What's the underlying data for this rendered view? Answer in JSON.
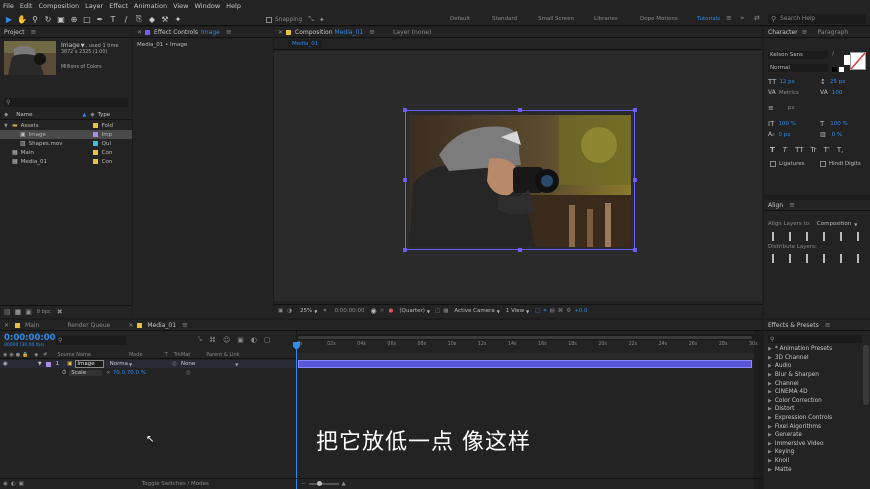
{
  "menu": [
    "File",
    "Edit",
    "Composition",
    "Layer",
    "Effect",
    "Animation",
    "View",
    "Window",
    "Help"
  ],
  "toolbar": {
    "snapping_label": "Snapping",
    "workspaces": [
      "Default",
      "Standard",
      "Small Screen",
      "Libraries",
      "Dope Motions",
      "Tutorials"
    ],
    "active_workspace": "Tutorials",
    "search_placeholder": "Search Help"
  },
  "project": {
    "title": "Project",
    "selected_name": "Image",
    "selected_used": ", used 1 time",
    "selected_dims": "3872 x 2325 (1.00)",
    "selected_colors": "Millions of Colors",
    "col_name": "Name",
    "col_type": "Type",
    "items": [
      {
        "name": "Assets",
        "type": "Fold",
        "color": "#e5c33c",
        "indent": 0,
        "kind": "folder"
      },
      {
        "name": "Image",
        "type": "Imp",
        "color": "#a98de8",
        "indent": 1,
        "kind": "image",
        "selected": true
      },
      {
        "name": "Shapes.mov",
        "type": "Qui",
        "color": "#38c5d6",
        "indent": 1,
        "kind": "movie"
      },
      {
        "name": "Main",
        "type": "Con",
        "color": "#e5c33c",
        "indent": 0,
        "kind": "comp"
      },
      {
        "name": "Media_01",
        "type": "Con",
        "color": "#e5c33c",
        "indent": 0,
        "kind": "comp"
      }
    ],
    "bpc": "8 bpc"
  },
  "effect_controls": {
    "title_prefix": "Effect Controls",
    "title_layer": "Image",
    "subtitle": "Media_01 • Image"
  },
  "composition": {
    "title_prefix": "Composition",
    "title_name": "Media_01",
    "layer_tab": "Layer (none)",
    "sub_tab": "Media_01",
    "zoom": "25%",
    "timecode": "0:00:00:00",
    "resolution": "(Quarter)",
    "camera": "Active Camera",
    "views": "1 View",
    "exposure": "+0.0"
  },
  "timeline": {
    "tabs": [
      "Main",
      "Render Queue",
      "Media_01"
    ],
    "active_tab": "Media_01",
    "timecode": "0:00:00:00",
    "fps": "00000 (30.00 fps)",
    "cols": {
      "num": "#",
      "source": "Source Name",
      "mode": "Mode",
      "t": "T",
      "trkmat": "TrkMat",
      "parent": "Parent & Link"
    },
    "layer": {
      "num": "1",
      "name": "Image",
      "mode": "Norma",
      "parent": "None"
    },
    "property": {
      "name": "Scale",
      "value": "70.0,70.0 %"
    },
    "ruler": [
      "0s",
      "02s",
      "04s",
      "06s",
      "08s",
      "10s",
      "12s",
      "14s",
      "16s",
      "18s",
      "20s",
      "22s",
      "24s",
      "26s",
      "28s",
      "30s"
    ],
    "toggle_label": "Toggle Switches / Modes",
    "subtitle": "把它放低一点 像这样"
  },
  "character": {
    "title": "Character",
    "paragraph_tab": "Paragraph",
    "font": "Kelson Sans",
    "style": "Normal",
    "size": "12 px",
    "leading": "25 px",
    "kerning": "Metrics",
    "tracking": "100",
    "stroke": "px",
    "vscale": "100 %",
    "hscale": "100 %",
    "baseline": "0 px",
    "tsume": "0 %",
    "styles": [
      "T",
      "T",
      "TT",
      "Tr",
      "T'",
      "T,"
    ],
    "ligatures": "Ligatures",
    "hindi": "Hindi Digits"
  },
  "align": {
    "title": "Align",
    "align_to_label": "Align Layers to:",
    "align_to_value": "Composition",
    "distribute_label": "Distribute Layers:"
  },
  "effects": {
    "title": "Effects & Presets",
    "items": [
      "* Animation Presets",
      "3D Channel",
      "Audio",
      "Blur & Sharpen",
      "Channel",
      "CINEMA 4D",
      "Color Correction",
      "Distort",
      "Expression Controls",
      "Fixel Algorithms",
      "Generate",
      "Immersive Video",
      "Keying",
      "Knoll",
      "Matte"
    ]
  },
  "colors": {
    "accent": "#2d8ceb",
    "layer_bar": "#5a55d6",
    "label_purple": "#a98de8",
    "label_yellow": "#e5c33c",
    "label_cyan": "#38c5d6"
  }
}
